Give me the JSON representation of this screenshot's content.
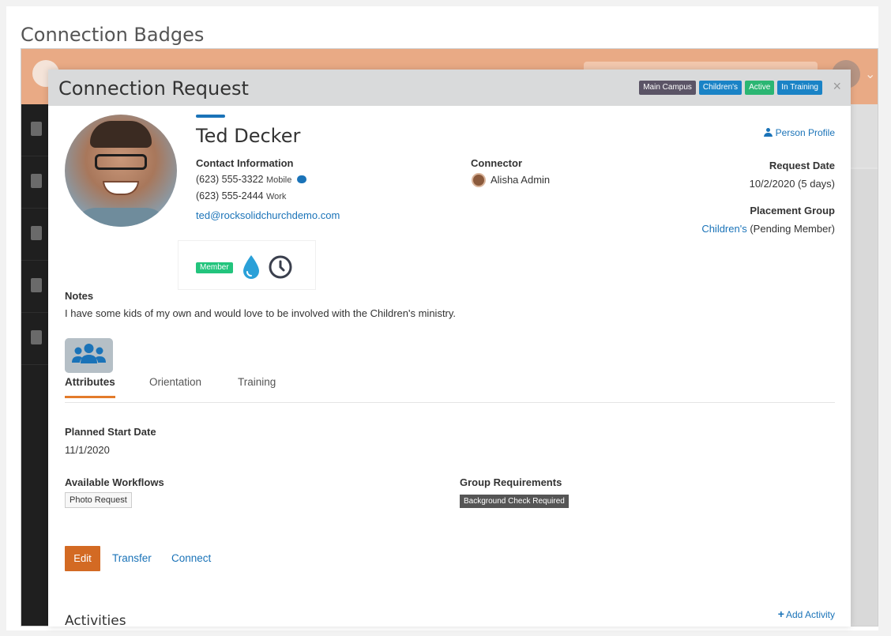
{
  "page": {
    "title": "Connection Badges"
  },
  "modal": {
    "title": "Connection Request",
    "labels": [
      {
        "text": "Main Campus",
        "color": "#5b5466"
      },
      {
        "text": "Children's",
        "color": "#1a83c6"
      },
      {
        "text": "Active",
        "color": "#2bb673"
      },
      {
        "text": "In Training",
        "color": "#1a83c6"
      }
    ],
    "close_icon": "×"
  },
  "person": {
    "name": "Ted Decker",
    "contact_title": "Contact Information",
    "phones": [
      {
        "number": "(623) 555-3322",
        "type": "Mobile"
      },
      {
        "number": "(623) 555-2444",
        "type": "Work"
      }
    ],
    "email": "ted@rocksolidchurchdemo.com",
    "profile_link": "Person Profile"
  },
  "connector": {
    "title": "Connector",
    "name": "Alisha Admin"
  },
  "request": {
    "date_title": "Request Date",
    "date_value": "10/2/2020 (5 days)",
    "placement_title": "Placement Group",
    "placement_group": "Children's",
    "placement_status": "(Pending Member)"
  },
  "badges": {
    "member_label": "Member",
    "icons": [
      "water-drop-icon",
      "clock-icon"
    ]
  },
  "notes": {
    "title": "Notes",
    "text": "I have some kids of my own and would love to be involved with the Children's ministry."
  },
  "tabs": [
    "Attributes",
    "Orientation",
    "Training"
  ],
  "attributes": {
    "planned_start_title": "Planned Start Date",
    "planned_start_value": "11/1/2020",
    "workflows_title": "Available Workflows",
    "workflows": [
      "Photo Request"
    ],
    "requirements_title": "Group Requirements",
    "requirements": [
      "Background Check Required"
    ]
  },
  "actions": {
    "edit": "Edit",
    "transfer": "Transfer",
    "connect": "Connect"
  },
  "activities": {
    "title": "Activities",
    "add_label": "Add Activity"
  }
}
